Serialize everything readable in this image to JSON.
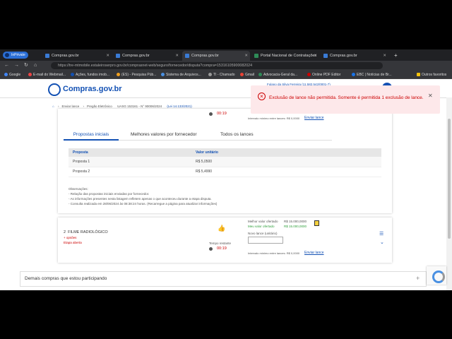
{
  "browser": {
    "inprivate_label": "InPrivate",
    "tabs": [
      {
        "label": "Compras.gov.br"
      },
      {
        "label": "Compras.gov.br"
      },
      {
        "label": "Compras.gov.br"
      },
      {
        "label": "Portal Nacional de Contratações"
      },
      {
        "label": "Compras.gov.br"
      }
    ],
    "address": "https://tre-mtmobile.estaleiroserpro.gov.br/comprasnet-web/seguro/fornecedor/disputa?compra=15316105900082024",
    "bookmarks": [
      "Google",
      "E-mail do Webmail...",
      "Ações, fundos imob...",
      "(ES) - Pesquisa Púb...",
      "Sistema de Arquivos...",
      "TI - Chamado",
      "Gmail",
      "Advocacia-Geral da...",
      "Online PDF Editor",
      "EBC | Notícias de Br...",
      "Outros favoritos"
    ],
    "accent_color": "#2b6fd6"
  },
  "header": {
    "logo_text": "Compras.gov.br",
    "user_text": "Fulano da Silva Ferreira (11.582.542/0001-7)"
  },
  "breadcrumb": {
    "items": [
      "Enviar lance",
      "Pregão Eletrônico",
      "UASG 153161 - N° 90006/2024",
      "(Lei 14.133/2021)"
    ]
  },
  "item_top": {
    "value": "00:19",
    "min_interval": "Intervalo mínimo entre lances: R$ 0,0000",
    "send_link": "Enviar lance"
  },
  "tabs": {
    "items": [
      "Propostas iniciais",
      "Melhores valores por fornecedor",
      "Todos os lances"
    ],
    "active": 0
  },
  "table": {
    "headers": [
      "Proposta",
      "Valor unitário"
    ],
    "rows": [
      [
        "Proposta 1",
        "R$ 5,0500"
      ],
      [
        "Proposta 2",
        "R$ 5,4990"
      ]
    ]
  },
  "observations": {
    "title": "Observações:",
    "lines": [
      "- Relação das propostas iniciais enviadas por fornecedor.",
      "- As informações presentes nesta listagem refletem apenas o que aconteceu durante a etapa disputa.",
      "- Consulta realizada em 28/06/2024 às 08:38:24 horas. (Recarregue a página para atualizar informações)"
    ]
  },
  "item2": {
    "number": "2",
    "name": "FILME RADIOLÓGICO",
    "subtitle": "+ opsões",
    "stage": "Etapa aberta",
    "best_value_label": "Melhor valor ofertado",
    "best_value": "R$ 15.000,0000",
    "my_best_label": "Meu valor ofertado",
    "my_best": "R$ 15.000,0000",
    "new_bid_label": "Novo lance",
    "unit_label": "(unitário)",
    "time_label": "Tempo restante",
    "time_value": "00:19",
    "min_interval": "Intervalo mínimo entre lances: R$ 0,0000",
    "send_link": "Enviar lance"
  },
  "toast": {
    "message": "Exclusão de lance não permitida. Somente é permitida 1 exclusão de lance.",
    "color": "#cc0000",
    "bg": "#fde8ea"
  },
  "footer": {
    "label": "Demais compras que estou participando",
    "plus": "+"
  },
  "icons": {
    "thumbs": "thumbs-up-icon",
    "trash": "trash-icon",
    "list": "list-icon",
    "chevron": "chevron-down-icon"
  }
}
